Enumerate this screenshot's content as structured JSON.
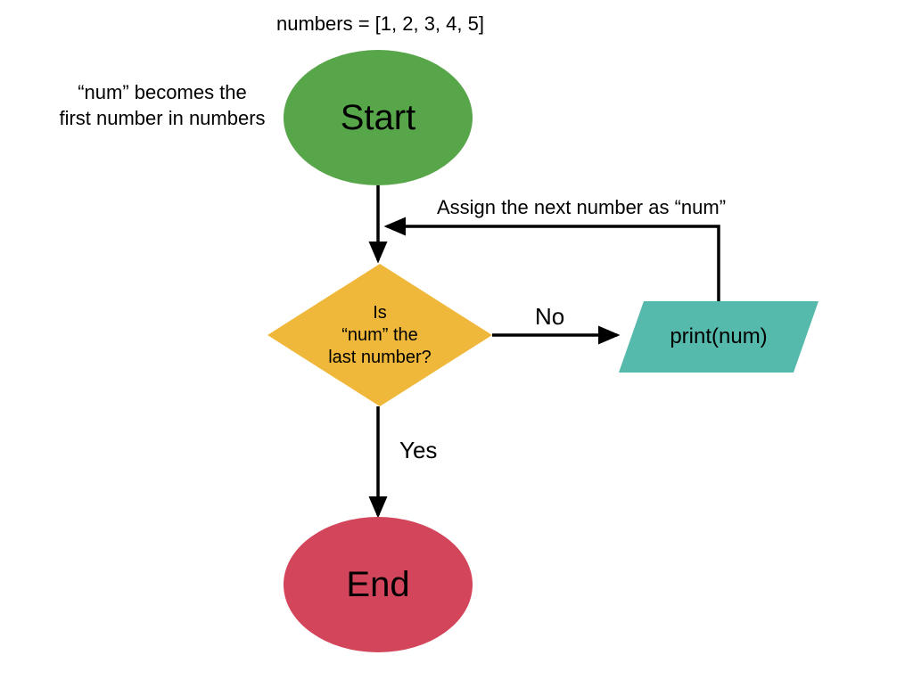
{
  "diagram": {
    "top_annotation": "numbers = [1, 2, 3, 4, 5]",
    "left_annotation_line1": "“num” becomes the",
    "left_annotation_line2": "first number in numbers",
    "start_label": "Start",
    "end_label": "End",
    "decision_line1": "Is",
    "decision_line2": "“num” the",
    "decision_line3": "last number?",
    "process_label": "print(num)",
    "loop_annotation": "Assign the next number as “num”",
    "edge_no": "No",
    "edge_yes": "Yes"
  },
  "colors": {
    "start": "#57a64a",
    "end": "#d2455a",
    "decision": "#f0b83b",
    "process": "#55b9ac",
    "arrow": "#000000"
  }
}
